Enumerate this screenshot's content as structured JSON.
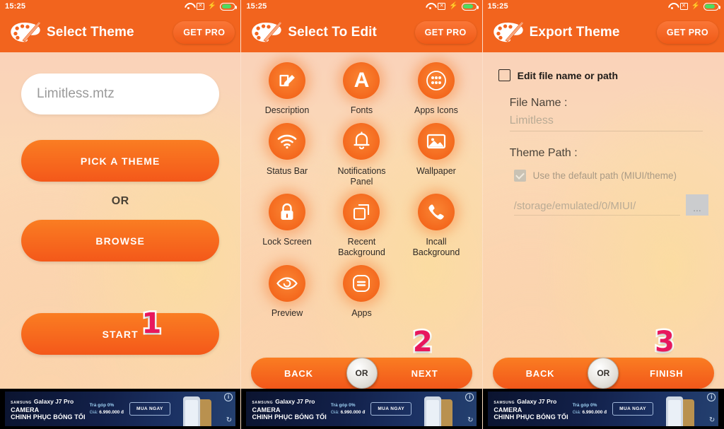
{
  "status_bar": {
    "time": "15:25",
    "icons": [
      "wifi-icon",
      "no-sim-icon",
      "charging-bolt-icon",
      "battery-icon"
    ]
  },
  "app": {
    "get_pro_label": "GET PRO",
    "logo_icon": "paint-palette-icon"
  },
  "screens": [
    {
      "title": "Select Theme",
      "file_field_value": "Limitless.mtz",
      "pick_theme_label": "PICK A THEME",
      "or_label": "OR",
      "browse_label": "BROWSE",
      "start_label": "START",
      "step_number": "1"
    },
    {
      "title": "Select To Edit",
      "step_number": "2",
      "grid": [
        {
          "label": "Description",
          "icon": "edit-square-pencil-icon"
        },
        {
          "label": "Fonts",
          "icon": "letter-a-icon"
        },
        {
          "label": "Apps Icons",
          "icon": "app-drawer-dots-icon"
        },
        {
          "label": "Status Bar",
          "icon": "wifi-signal-icon"
        },
        {
          "label": "Notifications Panel",
          "icon": "bell-icon"
        },
        {
          "label": "Wallpaper",
          "icon": "image-picture-icon"
        },
        {
          "label": "Lock Screen",
          "icon": "padlock-icon"
        },
        {
          "label": "Recent Background",
          "icon": "stacked-squares-icon"
        },
        {
          "label": "Incall Background",
          "icon": "phone-handset-icon"
        },
        {
          "label": "Preview",
          "icon": "eye-icon"
        },
        {
          "label": "Apps",
          "icon": "rounded-square-lines-icon"
        }
      ],
      "bottom_bar": {
        "back_label": "BACK",
        "or_label": "OR",
        "next_label": "NEXT"
      }
    },
    {
      "title": "Export Theme",
      "step_number": "3",
      "edit_checkbox_label": "Edit file name or path",
      "edit_checkbox_checked": false,
      "file_name_label": "File Name :",
      "file_name_value": "Limitless",
      "theme_path_label": "Theme Path :",
      "default_path_label": "Use the default path (MIUI/theme)",
      "default_path_checked": true,
      "path_value": "/storage/emulated/0/MIUI/",
      "browse_dots_label": "...",
      "bottom_bar": {
        "back_label": "BACK",
        "or_label": "OR",
        "finish_label": "FINISH"
      }
    }
  ],
  "ad": {
    "brand_mark": "SAMSUNG",
    "product": "Galaxy J7 Pro",
    "headline_1": "CAMERA",
    "headline_2": "CHINH PHỤC BÓNG TỐI",
    "promo_1": "Trả góp 0%",
    "promo_2_prefix": "Giá: ",
    "promo_2_price": "6.990.000 đ",
    "cta_label": "MUA NGAY",
    "info_label": "i",
    "replay_icon": "replay-icon"
  },
  "colors": {
    "accent_orange": "#f2641e",
    "button_orange": "#f4581a",
    "step_pink": "#e8175d",
    "battery_green": "#4ddc63"
  }
}
